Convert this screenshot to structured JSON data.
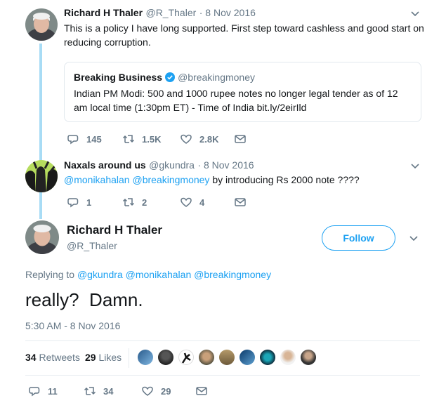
{
  "tweet1": {
    "name": "Richard H Thaler",
    "handle": "@R_Thaler",
    "date": "· 8 Nov 2016",
    "text": "This is a policy I have long supported. First step toward cashless and good start on reducing corruption.",
    "quote": {
      "name": "Breaking Business",
      "handle": "@breakingmoney",
      "text": "Indian PM Modi: 500 and 1000 rupee notes no longer legal tender as of 12 am local time (1:30pm ET) - Time of India ",
      "link": "bit.ly/2eirIld"
    },
    "replies": "145",
    "retweets": "1.5K",
    "likes": "2.8K"
  },
  "tweet2": {
    "name": "Naxals around us",
    "handle": "@gkundra",
    "date": "· 8 Nov 2016",
    "mention1": "@monikahalan",
    "mention2": "@breakingmoney",
    "text": " by introducing Rs 2000 note ????",
    "replies": "1",
    "retweets": "2",
    "likes": "4"
  },
  "main": {
    "name": "Richard H Thaler",
    "handle": "@R_Thaler",
    "follow_label": "Follow",
    "replying_to": "Replying to",
    "reply_mentions": [
      "@gkundra",
      "@monikahalan",
      "@breakingmoney"
    ],
    "text": "really?  Damn.",
    "timestamp": "5:30 AM - 8 Nov 2016",
    "retweet_count": "34",
    "retweet_label": "Retweets",
    "like_count": "29",
    "like_label": "Likes",
    "replies": "11",
    "retweets": "34",
    "likes": "29"
  },
  "colors": {
    "accent": "#1da1f2",
    "thread_line": "#a8dcf5",
    "muted": "#657786"
  },
  "icons": {
    "reply": "reply-icon",
    "retweet": "retweet-icon",
    "like": "heart-icon",
    "dm": "envelope-icon",
    "more": "chevron-down-icon",
    "verified": "verified-badge-icon"
  }
}
